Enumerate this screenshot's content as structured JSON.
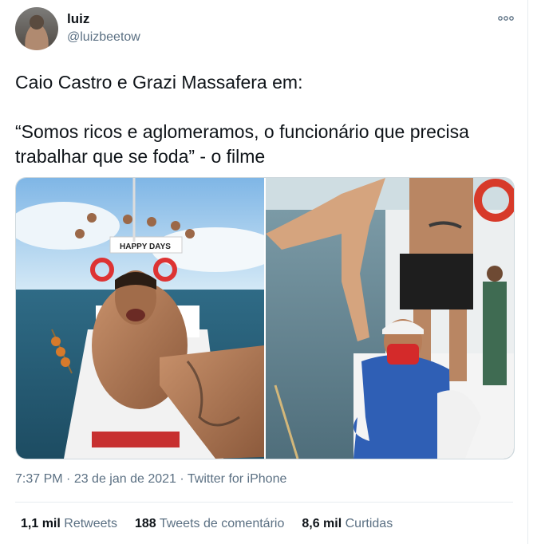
{
  "author": {
    "name": "luiz",
    "handle": "@luizbeetow"
  },
  "tweet": {
    "text": "Caio Castro e Grazi Massafera em:\n\n“Somos ricos e aglomeramos, o funcionário que precisa trabalhar que se foda” - o filme"
  },
  "media": {
    "boat_banner": "HAPPY DAYS"
  },
  "meta": {
    "time": "7:37 PM",
    "separator1": " · ",
    "date": "23 de jan de 2021",
    "separator2": " · ",
    "source": "Twitter for iPhone"
  },
  "stats": [
    {
      "count": "1,1 mil",
      "label": "Retweets"
    },
    {
      "count": "188",
      "label": "Tweets de comentário"
    },
    {
      "count": "8,6 mil",
      "label": "Curtidas"
    }
  ],
  "icons": {
    "more": "more-horizontal-icon"
  },
  "colors": {
    "text": "#0f1419",
    "secondary": "#5b7083",
    "border": "#e6ecf0"
  }
}
